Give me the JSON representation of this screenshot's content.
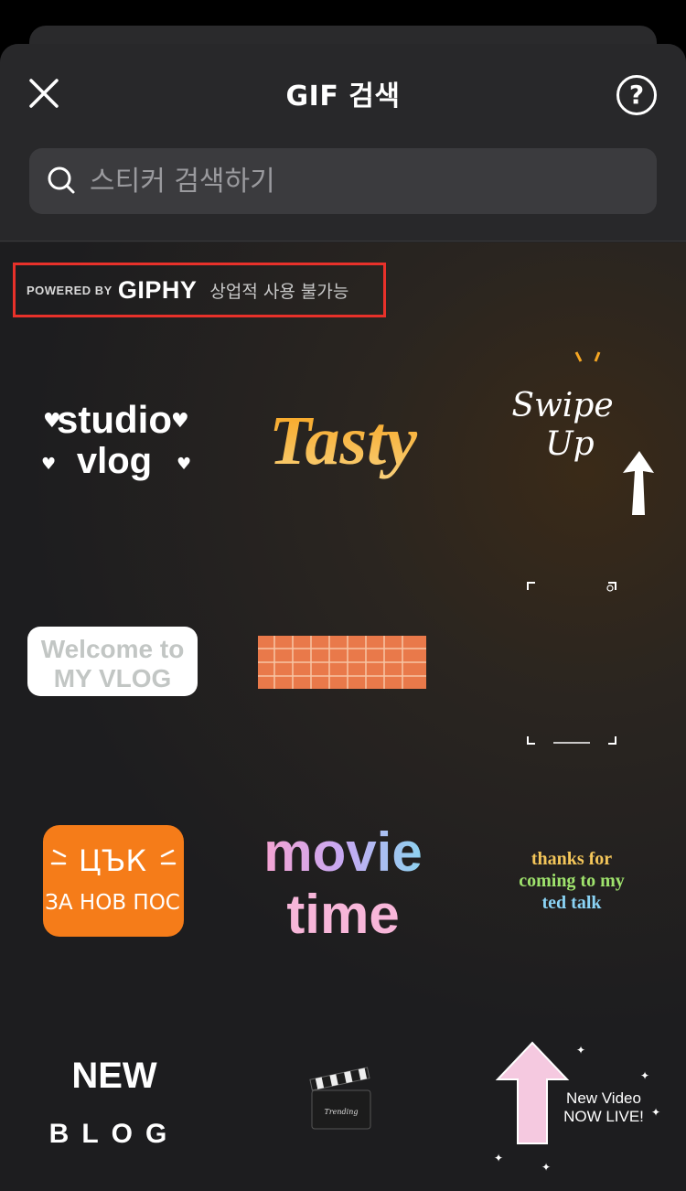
{
  "header": {
    "title": "GIF 검색",
    "help_icon": "question-icon",
    "close_icon": "close-icon"
  },
  "search": {
    "placeholder": "스티커 검색하기",
    "icon": "search-icon"
  },
  "attribution": {
    "powered_by": "POWERED BY",
    "brand": "GIPHY",
    "notice": "상업적 사용 불가능",
    "highlight_color": "#e8312a"
  },
  "stickers": [
    {
      "line1": "studio",
      "line2": "vlog"
    },
    {
      "text": "Tasty"
    },
    {
      "line1": "Swipe",
      "line2": "Up"
    },
    {
      "line1": "Welcome to",
      "line2": "MY VLOG"
    },
    {
      "style": "orange-grid-tape"
    },
    {
      "style": "camera-frame"
    },
    {
      "line1": "ЦЪК",
      "line2": "ЗА НОВ ПОС"
    },
    {
      "line1": "movie",
      "line2": "time"
    },
    {
      "line1": "thanks for",
      "line2": "coming to my",
      "line3": "ted talk"
    },
    {
      "line1": "NEW",
      "line2": "BLOG"
    },
    {
      "label": "Trending"
    },
    {
      "line1": "New Video",
      "line2": "NOW LIVE!"
    }
  ]
}
